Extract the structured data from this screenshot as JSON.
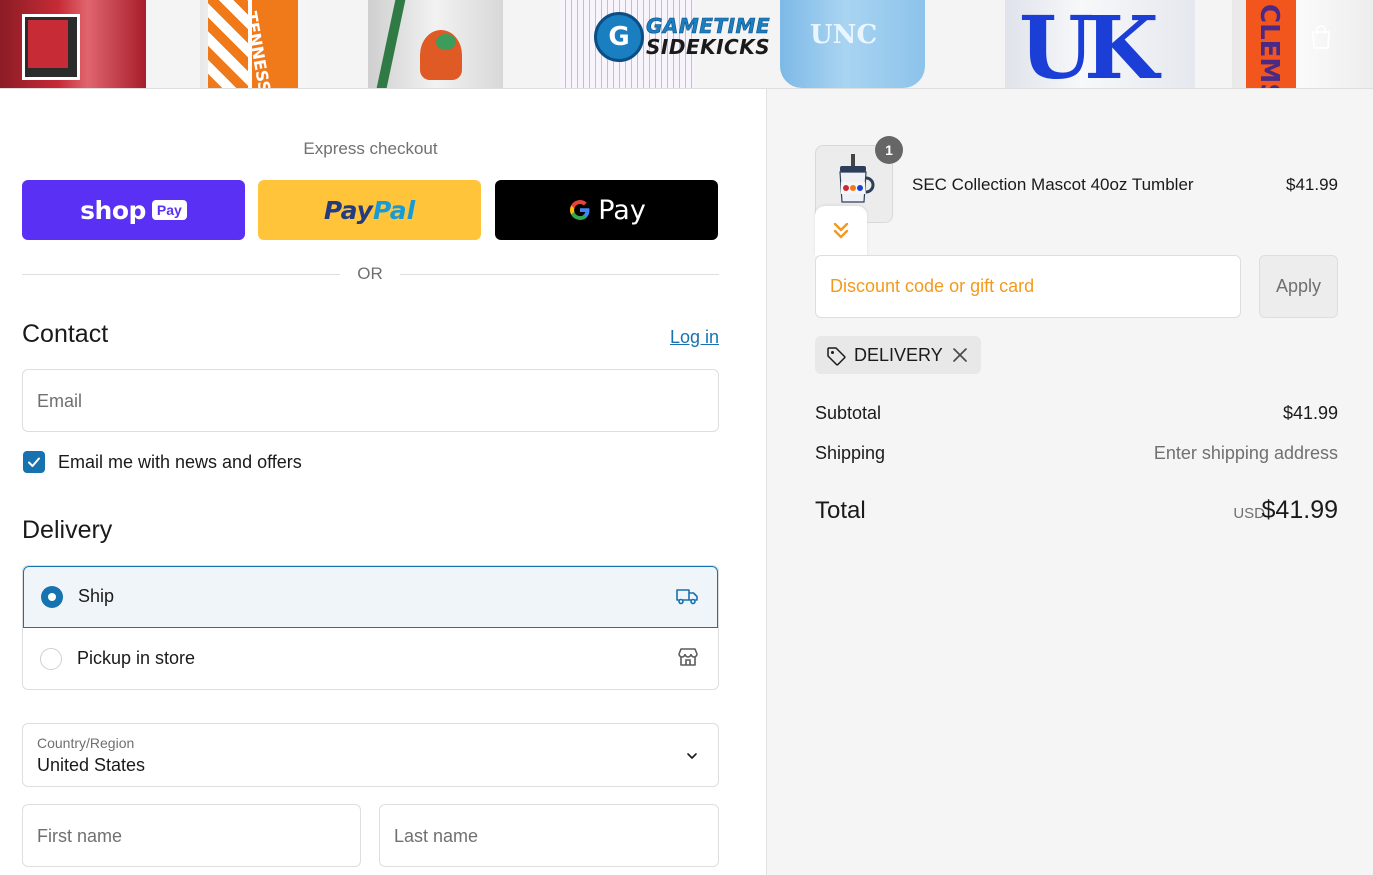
{
  "header": {
    "logo_line1": "GAMETIME",
    "logo_line2": "SIDEKICKS",
    "banner_texts": {
      "tennessee": "TENNESSEE",
      "unc": "UNC",
      "uk": "UK",
      "clemson": "CLEMS"
    }
  },
  "express": {
    "title": "Express checkout",
    "shoppay_word": "shop",
    "shoppay_pay": "Pay",
    "paypal_p1": "Pay",
    "paypal_p2": "Pal",
    "gpay_g": "G",
    "gpay_word": "Pay",
    "or": "OR"
  },
  "contact": {
    "heading": "Contact",
    "login": "Log in",
    "email_placeholder": "Email",
    "newsletter_label": "Email me with news and offers",
    "newsletter_checked": true
  },
  "delivery": {
    "heading": "Delivery",
    "options": [
      {
        "label": "Ship",
        "selected": true,
        "icon": "truck-icon"
      },
      {
        "label": "Pickup in store",
        "selected": false,
        "icon": "store-icon"
      }
    ],
    "country_label": "Country/Region",
    "country_value": "United States",
    "first_name_placeholder": "First name",
    "last_name_placeholder": "Last name"
  },
  "summary": {
    "item": {
      "name": "SEC Collection Mascot 40oz Tumbler",
      "price": "$41.99",
      "quantity": "1"
    },
    "discount_placeholder": "Discount code or gift card",
    "apply": "Apply",
    "applied_code": "DELIVERY",
    "subtotal_label": "Subtotal",
    "subtotal_value": "$41.99",
    "shipping_label": "Shipping",
    "shipping_value": "Enter shipping address",
    "total_label": "Total",
    "currency": "USD",
    "total_value": "$41.99"
  },
  "colors": {
    "accent": "#1773b0",
    "shoppay": "#5a31f4",
    "paypal": "#ffc439",
    "gpay": "#000000",
    "discount_placeholder": "#f39a1e"
  }
}
